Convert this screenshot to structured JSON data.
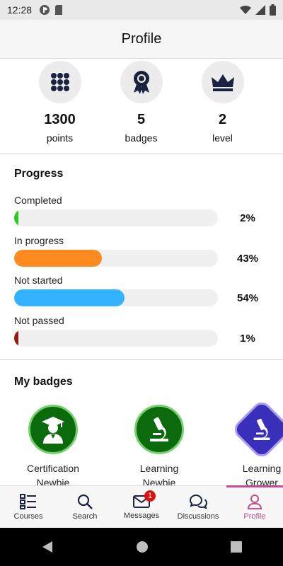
{
  "status": {
    "time": "12:28"
  },
  "header": {
    "title": "Profile"
  },
  "stats": [
    {
      "value": "1300",
      "label": "points",
      "icon": "grid-icon"
    },
    {
      "value": "5",
      "label": "badges",
      "icon": "award-icon"
    },
    {
      "value": "2",
      "label": "level",
      "icon": "crown-icon"
    }
  ],
  "progress": {
    "title": "Progress",
    "items": [
      {
        "label": "Completed",
        "percent_text": "2%",
        "value": 2,
        "color": "#2ecc1a"
      },
      {
        "label": "In progress",
        "percent_text": "43%",
        "value": 43,
        "color": "#ff8a1f"
      },
      {
        "label": "Not started",
        "percent_text": "54%",
        "value": 54,
        "color": "#33b3ff"
      },
      {
        "label": "Not passed",
        "percent_text": "1%",
        "value": 1,
        "color": "#9a1a10"
      }
    ]
  },
  "badges": {
    "title": "My badges",
    "items": [
      {
        "line1": "Certification",
        "line2": "Newbie",
        "icon": "graduate-icon"
      },
      {
        "line1": "Learning",
        "line2": "Newbie",
        "icon": "microscope-icon"
      },
      {
        "line1": "Learning",
        "line2": "Grower",
        "icon": "microscope-icon"
      }
    ]
  },
  "tabs": [
    {
      "label": "Courses",
      "icon": "courses-icon"
    },
    {
      "label": "Search",
      "icon": "search-icon"
    },
    {
      "label": "Messages",
      "icon": "mail-icon",
      "count": "1"
    },
    {
      "label": "Discussions",
      "icon": "chat-icon"
    },
    {
      "label": "Profile",
      "icon": "user-icon",
      "active": true
    }
  ]
}
